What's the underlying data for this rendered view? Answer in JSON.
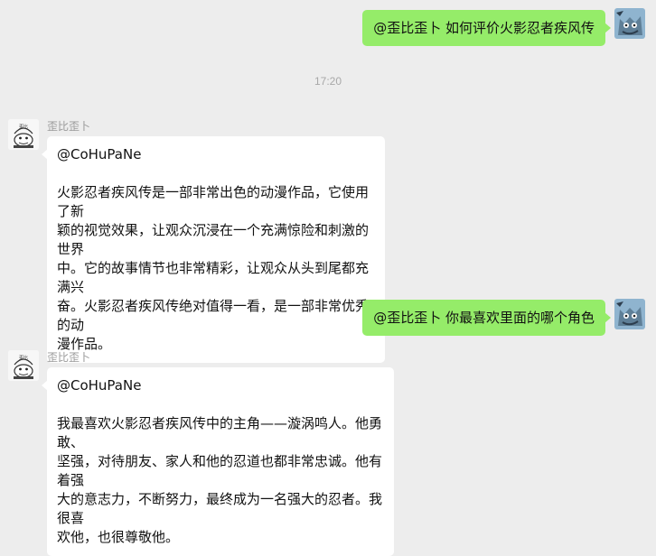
{
  "chat": {
    "timestamp": "17:20",
    "messages": [
      {
        "type": "outgoing",
        "text": "@歪比歪卜 如何评价火影忍者疾风传"
      },
      {
        "type": "incoming",
        "sender": "歪比歪卜",
        "mention": "@CoHuPaNe",
        "lines": [
          "火影忍者疾风传是一部非常出色的动漫作品，它使用了新",
          "颖的视觉效果，让观众沉浸在一个充满惊险和刺激的世界",
          "中。它的故事情节也非常精彩，让观众从头到尾都充满兴",
          "奋。火影忍者疾风传绝对值得一看，是一部非常优秀的动",
          "漫作品。"
        ]
      },
      {
        "type": "outgoing",
        "text": "@歪比歪卜 你最喜欢里面的哪个角色"
      },
      {
        "type": "incoming",
        "sender": "歪比歪卜",
        "mention": "@CoHuPaNe",
        "lines": [
          "我最喜欢火影忍者疾风传中的主角——漩涡鸣人。他勇敢、",
          "坚强，对待朋友、家人和他的忍道也都非常忠诚。他有着强",
          "大的意志力，不断努力，最终成为一名强大的忍者。我很喜",
          "欢他，也很尊敬他。"
        ]
      }
    ]
  },
  "colors": {
    "background": "#ededed",
    "outgoing_bubble": "#95ec69",
    "incoming_bubble": "#ffffff"
  },
  "icons": {
    "user_avatar": "cat-cartoon-avatar",
    "bot_avatar": "doraemon-sketch-avatar"
  }
}
